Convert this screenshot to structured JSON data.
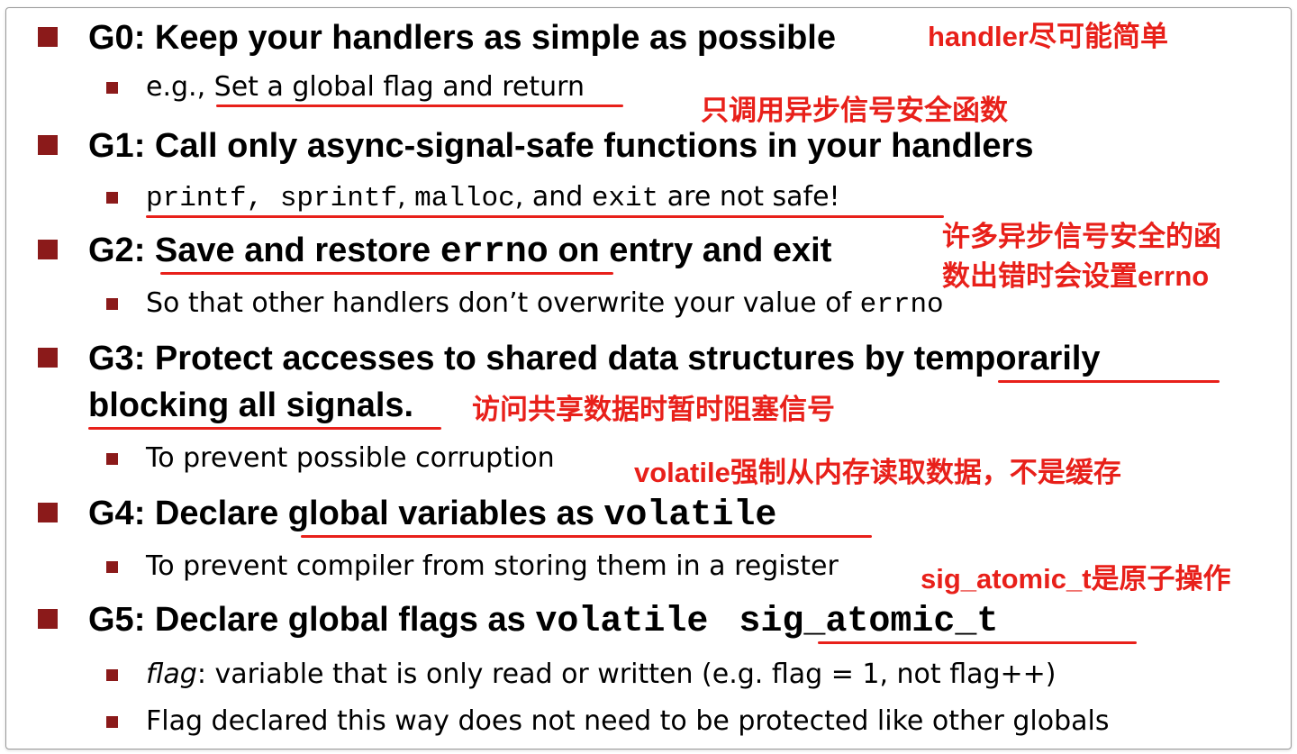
{
  "colors": {
    "bullet": "#8b1a1a",
    "annotation": "#e8201a",
    "text": "#000000"
  },
  "g0": {
    "heading": "G0: Keep your handlers as simple as possible",
    "note": "handler尽可能简单",
    "sub": {
      "prefix": "e.g., ",
      "rest": "Set a global flag and return"
    }
  },
  "g1": {
    "note": "只调用异步信号安全函数",
    "heading": "G1: Call only async-signal-safe functions in your handlers",
    "sub": {
      "f1": "printf, sprintf",
      "sep1": ", ",
      "f2": "malloc",
      "sep2": ", and ",
      "f3": "exit",
      "rest": " are not safe!"
    }
  },
  "g2": {
    "prefix": "G2: ",
    "part1": "Save and restore ",
    "code": "errno",
    "rest": " on entry and exit",
    "note_line1": "许多异步信号安全的函",
    "note_line2": "数出错时会设置errno",
    "sub": {
      "text": "So that other handlers don’t overwrite your value of ",
      "code": "errno"
    }
  },
  "g3": {
    "line1_prefix": "G3: Protect accesses to shared data structures by ",
    "line1_emph": "temporarily",
    "line2": "blocking all signals.",
    "note": "访问共享数据时暂时阻塞信号",
    "sub": "To prevent possible corruption"
  },
  "g4": {
    "note": "volatile强制从内存读取数据，不是缓存",
    "prefix": "G4: Declare ",
    "emph": "global variables as ",
    "code": "volatile",
    "sub": "To prevent compiler from storing them in a register"
  },
  "g5": {
    "note": "sig_atomic_t是原子操作",
    "prefix": "G5: Declare global flags as ",
    "code1": "volatile",
    "code2": "sig_atomic_t",
    "sub1": {
      "em": "flag",
      "rest": ": variable that is only read or written (e.g. flag = 1, not flag++)"
    },
    "sub2": "Flag declared this way does not need to be protected  like other globals"
  }
}
